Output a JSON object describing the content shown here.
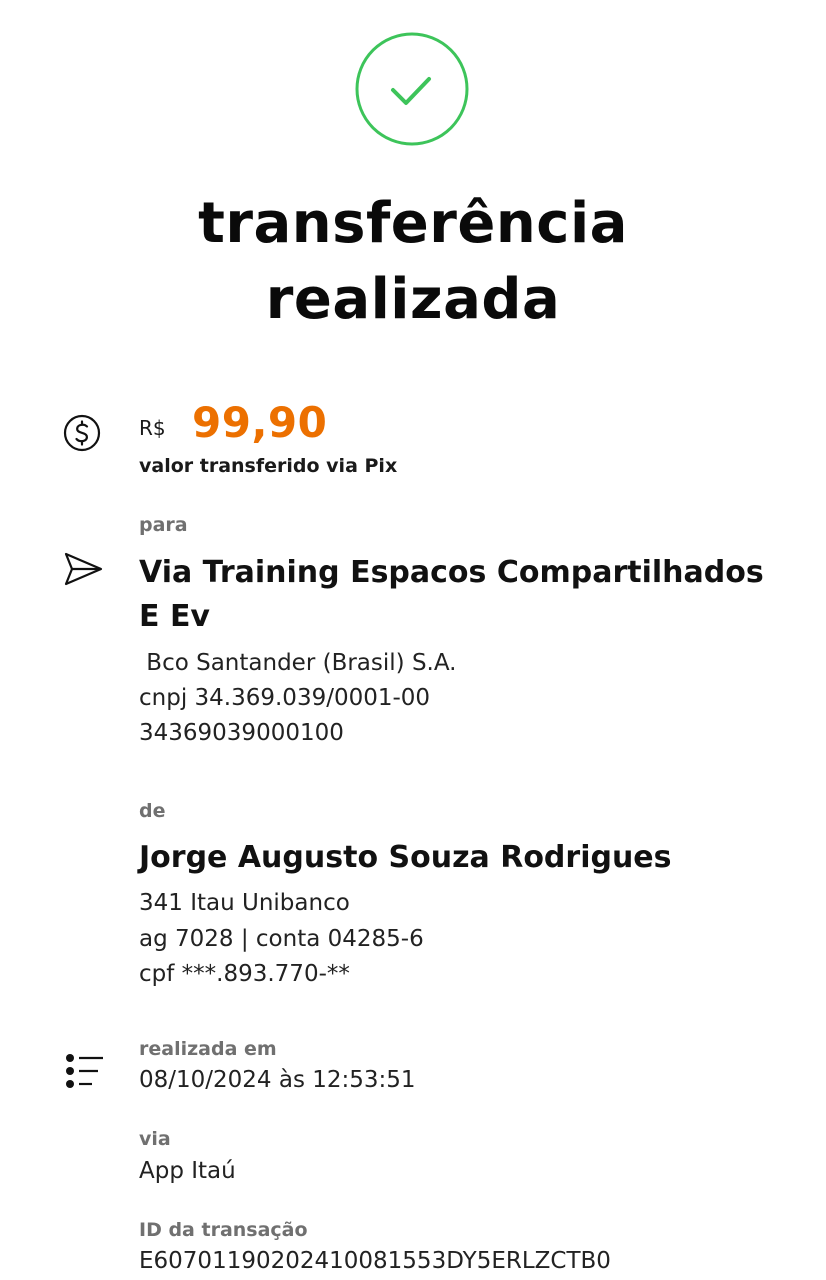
{
  "status": {
    "title_line1": "transferência",
    "title_line2": "realizada",
    "icon": "check-circle-icon",
    "icon_color": "#3dc45a"
  },
  "amount": {
    "currency": "R$",
    "value": "99,90",
    "caption": "valor transferido via Pix",
    "value_color": "#ec7000",
    "icon": "dollar-circle-icon"
  },
  "recipient": {
    "label": "para",
    "name": "Via Training Espacos Compartilhados E Ev",
    "bank": " Bco Santander (Brasil) S.A.",
    "document": "cnpj 34.369.039/0001-00",
    "key": "34369039000100",
    "icon": "send-icon"
  },
  "sender": {
    "label": "de",
    "name": "Jorge Augusto Souza Rodrigues",
    "bank": "341 Itau Unibanco",
    "account": "ag 7028 | conta 04285-6",
    "document": "cpf ***.893.770-**"
  },
  "details": {
    "icon": "list-icon",
    "date_label": "realizada em",
    "date_value": "08/10/2024 às 12:53:51",
    "channel_label": "via",
    "channel_value": "App Itaú",
    "transaction_id_label": "ID da transação",
    "transaction_id_value": "E60701190202410081553DY5ERLZCTB0"
  }
}
